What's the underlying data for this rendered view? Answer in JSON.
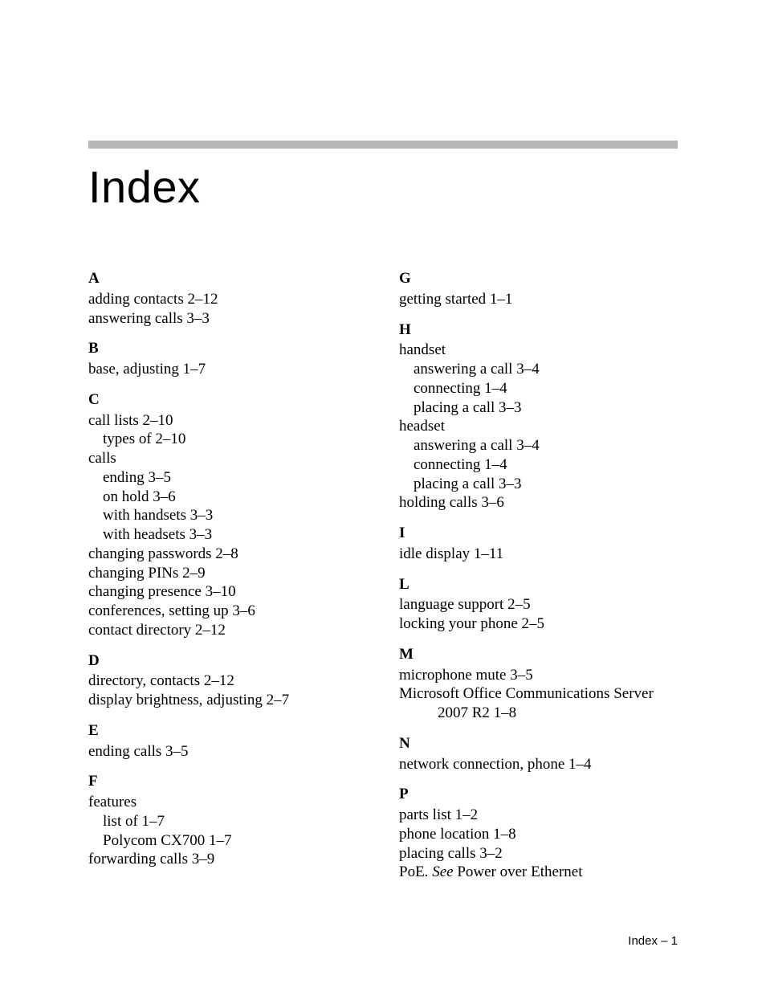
{
  "title": "Index",
  "footer": "Index – 1",
  "left": {
    "sections": [
      {
        "letter": "A",
        "entries": [
          {
            "text": "adding contacts 2–12"
          },
          {
            "text": "answering calls 3–3"
          }
        ]
      },
      {
        "letter": "B",
        "entries": [
          {
            "text": "base, adjusting 1–7"
          }
        ]
      },
      {
        "letter": "C",
        "entries": [
          {
            "text": "call lists 2–10"
          },
          {
            "text": "types of 2–10",
            "sub": true
          },
          {
            "text": "calls"
          },
          {
            "text": "ending 3–5",
            "sub": true
          },
          {
            "text": "on hold 3–6",
            "sub": true
          },
          {
            "text": "with handsets 3–3",
            "sub": true
          },
          {
            "text": "with headsets 3–3",
            "sub": true
          },
          {
            "text": "changing passwords 2–8"
          },
          {
            "text": "changing PINs 2–9"
          },
          {
            "text": "changing presence 3–10"
          },
          {
            "text": "conferences, setting up 3–6"
          },
          {
            "text": "contact directory 2–12"
          }
        ]
      },
      {
        "letter": "D",
        "entries": [
          {
            "text": "directory, contacts 2–12"
          },
          {
            "text": "display brightness, adjusting 2–7"
          }
        ]
      },
      {
        "letter": "E",
        "entries": [
          {
            "text": "ending calls 3–5"
          }
        ]
      },
      {
        "letter": "F",
        "entries": [
          {
            "text": "features"
          },
          {
            "text": "list of 1–7",
            "sub": true
          },
          {
            "text": "Polycom CX700 1–7",
            "sub": true
          },
          {
            "text": "forwarding calls 3–9"
          }
        ]
      }
    ]
  },
  "right": {
    "sections": [
      {
        "letter": "G",
        "entries": [
          {
            "text": "getting started 1–1"
          }
        ]
      },
      {
        "letter": "H",
        "entries": [
          {
            "text": "handset"
          },
          {
            "text": "answering a call 3–4",
            "sub": true
          },
          {
            "text": "connecting 1–4",
            "sub": true
          },
          {
            "text": "placing a call 3–3",
            "sub": true
          },
          {
            "text": "headset"
          },
          {
            "text": "answering a call 3–4",
            "sub": true
          },
          {
            "text": "connecting 1–4",
            "sub": true
          },
          {
            "text": "placing a call 3–3",
            "sub": true
          },
          {
            "text": "holding calls 3–6"
          }
        ]
      },
      {
        "letter": "I",
        "entries": [
          {
            "text": "idle display 1–11"
          }
        ]
      },
      {
        "letter": "L",
        "entries": [
          {
            "text": "language support 2–5"
          },
          {
            "text": "locking your phone 2–5"
          }
        ]
      },
      {
        "letter": "M",
        "entries": [
          {
            "text": "microphone mute 3–5"
          },
          {
            "text": "Microsoft Office Communications Server 2007 R2 1–8",
            "hang": true
          }
        ]
      },
      {
        "letter": "N",
        "entries": [
          {
            "text": "network connection, phone 1–4"
          }
        ]
      },
      {
        "letter": "P",
        "entries": [
          {
            "text": "parts list 1–2"
          },
          {
            "text": "phone location 1–8"
          },
          {
            "text": "placing calls 3–2"
          },
          {
            "prefix": "PoE. ",
            "italic": "See",
            "suffix": " Power over Ethernet"
          }
        ]
      }
    ]
  }
}
